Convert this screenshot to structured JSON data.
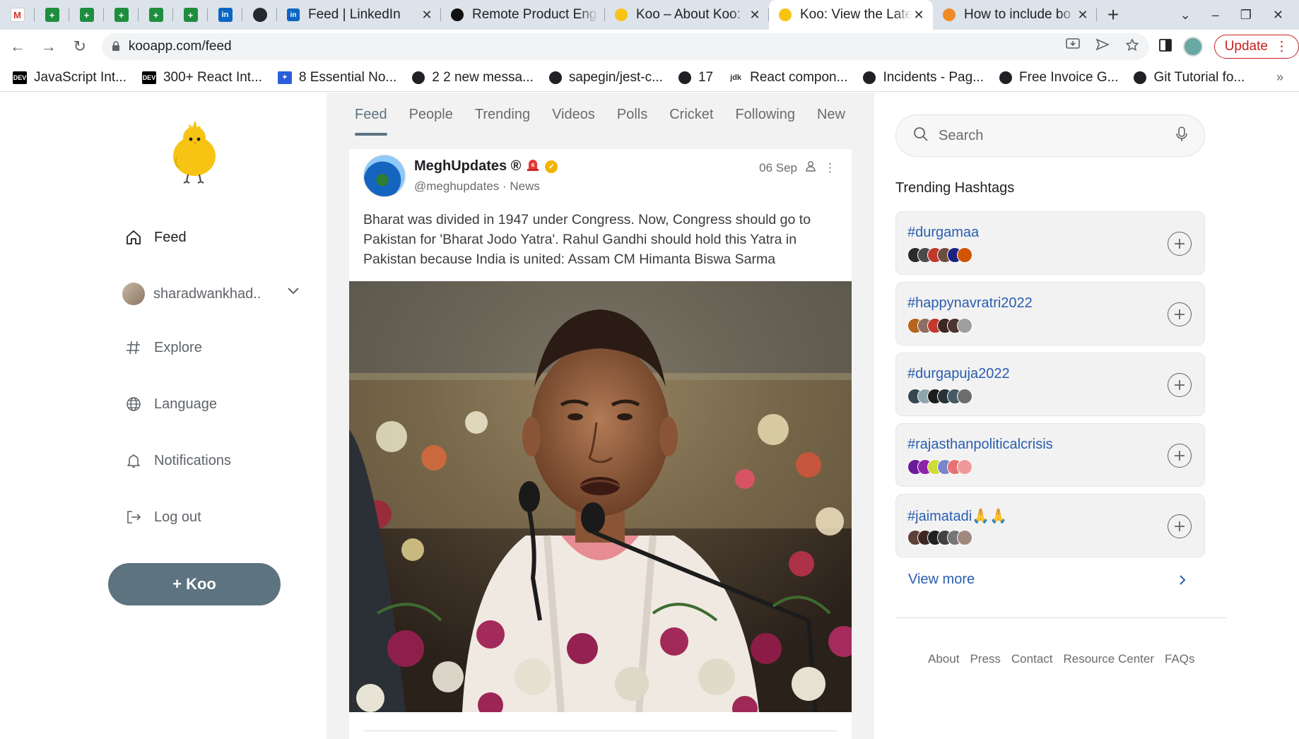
{
  "browser": {
    "pinned_tabs": [
      {
        "icon": "gmail-icon",
        "glyph": "M"
      },
      {
        "icon": "sheets-icon",
        "glyph": "+"
      },
      {
        "icon": "sheets-icon",
        "glyph": "+"
      },
      {
        "icon": "sheets-icon",
        "glyph": "+"
      },
      {
        "icon": "sheets-icon",
        "glyph": "+"
      },
      {
        "icon": "sheets-icon",
        "glyph": "+"
      },
      {
        "icon": "linkedin-icon",
        "glyph": "in"
      },
      {
        "icon": "github-icon",
        "glyph": ""
      }
    ],
    "tabs": [
      {
        "title": "Feed | LinkedIn",
        "favicon": "in",
        "color": "#0a66c2"
      },
      {
        "title": "Remote Product Eng",
        "favicon": "",
        "color": "#111111"
      },
      {
        "title": "Koo – About Koo:",
        "favicon": "",
        "color": "#f7c414"
      },
      {
        "title": "Koo: View the Late",
        "favicon": "",
        "color": "#f7c414"
      },
      {
        "title": "How to include bo",
        "favicon": "",
        "color": "#f08a24"
      }
    ],
    "new_tab": "+",
    "window_controls": [
      "⌄",
      "–",
      "❐",
      "✕"
    ],
    "url": "kooapp.com/feed",
    "update_label": "Update",
    "bookmarks": [
      {
        "label": "JavaScript Int...",
        "icon": "DEV",
        "kind": "dev"
      },
      {
        "label": "300+ React Int...",
        "icon": "DEV",
        "kind": "dev"
      },
      {
        "label": "8 Essential No...",
        "icon": "✦",
        "kind": "blue"
      },
      {
        "label": "2 2 new messa...",
        "icon": "",
        "kind": "globe"
      },
      {
        "label": "sapegin/jest-c...",
        "icon": "",
        "kind": "globe"
      },
      {
        "label": "17",
        "icon": "",
        "kind": "globe"
      },
      {
        "label": "React compon...",
        "icon": "jdk",
        "kind": "jd"
      },
      {
        "label": "Incidents - Pag...",
        "icon": "",
        "kind": "globe"
      },
      {
        "label": "Free Invoice G...",
        "icon": "",
        "kind": "globe"
      },
      {
        "label": "Git Tutorial fo...",
        "icon": "",
        "kind": "globe"
      }
    ],
    "bookmarks_more": "»"
  },
  "sidebar": {
    "nav": [
      {
        "label": "Feed",
        "icon": "home-icon"
      },
      {
        "label": "sharadwankhad..",
        "icon": "avatar"
      },
      {
        "label": "Explore",
        "icon": "hashtag-icon"
      },
      {
        "label": "Language",
        "icon": "globe-icon"
      },
      {
        "label": "Notifications",
        "icon": "bell-icon"
      },
      {
        "label": "Log out",
        "icon": "logout-icon"
      }
    ],
    "koo_button": "+ Koo"
  },
  "feed": {
    "tabs": [
      "Feed",
      "People",
      "Trending",
      "Videos",
      "Polls",
      "Cricket",
      "Following",
      "New"
    ],
    "active_tab": "Feed",
    "post": {
      "name": "MeghUpdates ®",
      "handle": "@meghupdates · News",
      "date": "06 Sep",
      "text": "Bharat was divided in 1947 under Congress. Now, Congress should go to Pakistan for 'Bharat Jodo Yatra'. Rahul Gandhi should hold this Yatra in Pakistan because India is united: Assam CM Himanta Biswa Sarma"
    }
  },
  "right": {
    "search_placeholder": "Search",
    "trending_title": "Trending Hashtags",
    "hashtags": [
      {
        "tag": "#durgamaa",
        "avatars": [
          "#2b2b2b",
          "#4a4a4a",
          "#c0392b",
          "#6d4c41",
          "#1a237e",
          "#d35400"
        ]
      },
      {
        "tag": "#happynavratri2022",
        "avatars": [
          "#b5651d",
          "#8d6e63",
          "#c0392b",
          "#3e2723",
          "#4e342e",
          "#9e9e9e"
        ]
      },
      {
        "tag": "#durgapuja2022",
        "avatars": [
          "#37474f",
          "#90a4ae",
          "#1c1c1c",
          "#263238",
          "#455a64",
          "#6d6d6d"
        ]
      },
      {
        "tag": "#rajasthanpoliticalcrisis",
        "avatars": [
          "#6a1b9a",
          "#8e24aa",
          "#cddc39",
          "#7986cb",
          "#e57373",
          "#ef9a9a"
        ]
      },
      {
        "tag": "#jaimatadi🙏🙏",
        "avatars": [
          "#5d4037",
          "#3e2723",
          "#212121",
          "#424242",
          "#757575",
          "#a1887f"
        ]
      }
    ],
    "view_more": "View more",
    "footer_links": [
      "About",
      "Press",
      "Contact",
      "Resource Center",
      "FAQs"
    ]
  }
}
